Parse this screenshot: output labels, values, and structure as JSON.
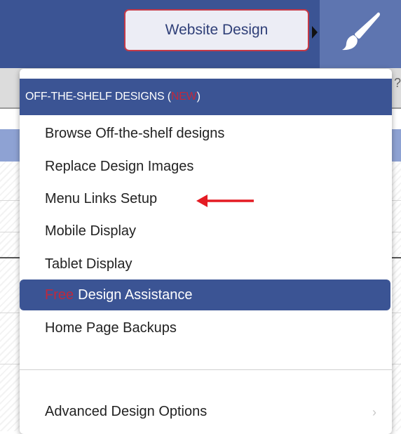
{
  "toolbar": {
    "tooltip_label": "Website Design",
    "brush_icon": "paintbrush-icon"
  },
  "dropdown": {
    "header": {
      "prefix": "OFF-THE-SHELF DESIGNS (",
      "badge": "NEW",
      "suffix": ")"
    },
    "items": [
      {
        "label": "Browse Off-the-shelf designs"
      },
      {
        "label": "Replace Design Images"
      },
      {
        "label": "Menu Links Setup"
      },
      {
        "label": "Mobile Display"
      },
      {
        "label": "Tablet Display"
      },
      {
        "label_free": "Free",
        "label": "Design Assistance",
        "highlighted": true
      },
      {
        "label": "Home Page Backups"
      }
    ],
    "advanced": {
      "label": "Advanced Design Options",
      "chevron": "›"
    }
  },
  "annotation": {
    "arrow_icon": "red-arrow-icon",
    "points_to": "Menu Links Setup"
  },
  "colors": {
    "navy": "#3b5494",
    "brush_box": "#5e75b0",
    "accent_red": "#c0283c",
    "tooltip_border": "#c43a48"
  }
}
